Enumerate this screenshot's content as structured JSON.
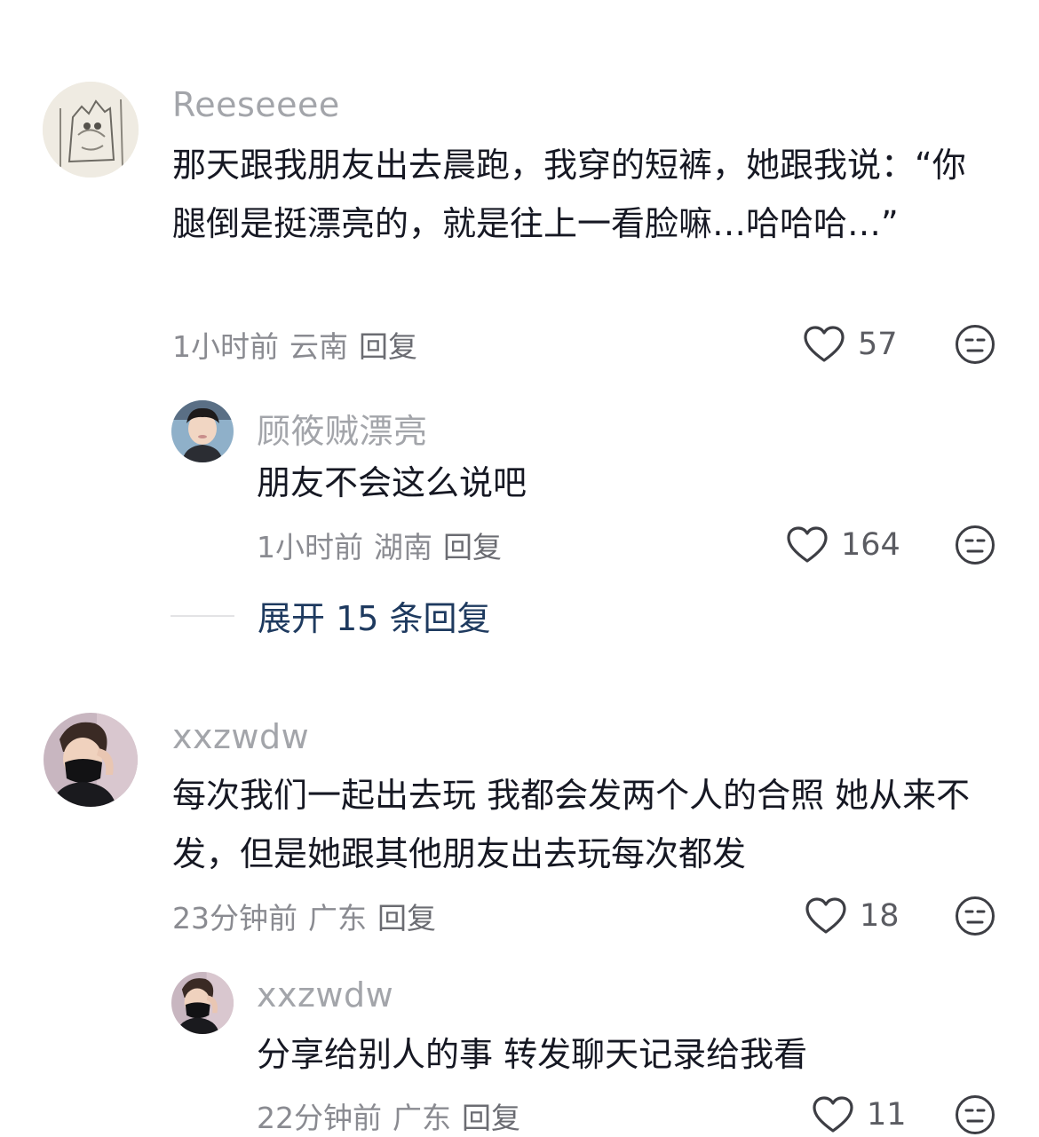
{
  "comments": [
    {
      "username": "Reeseeee",
      "text": "那天跟我朋友出去晨跑，我穿的短裤，她跟我说：“你腿倒是挺漂亮的，就是往上一看脸嘛…哈哈哈…”",
      "time": "1小时前",
      "location": "云南",
      "reply_label": "回复",
      "likes": "57",
      "avatar_icon": "sketch-drawing-avatar",
      "replies": [
        {
          "username": "顾筱贼漂亮",
          "text": "朋友不会这么说吧",
          "time": "1小时前",
          "location": "湖南",
          "reply_label": "回复",
          "likes": "164",
          "avatar_icon": "person-photo-avatar"
        }
      ],
      "expand_label": "展开 15 条回复"
    },
    {
      "username": "xxzwdw",
      "text": "每次我们一起出去玩 我都会发两个人的合照 她从来不发，但是她跟其他朋友出去玩每次都发",
      "time": "23分钟前",
      "location": "广东",
      "reply_label": "回复",
      "likes": "18",
      "avatar_icon": "masked-person-avatar",
      "replies": [
        {
          "username": "xxzwdw",
          "text": "分享给别人的事 转发聊天记录给我看",
          "time": "22分钟前",
          "location": "广东",
          "reply_label": "回复",
          "likes": "11",
          "avatar_icon": "masked-person-avatar"
        }
      ]
    }
  ],
  "colors": {
    "username": "#a3a5aa",
    "text": "#161823",
    "meta": "#8a8b91",
    "expand_link": "#1e3a5f"
  }
}
